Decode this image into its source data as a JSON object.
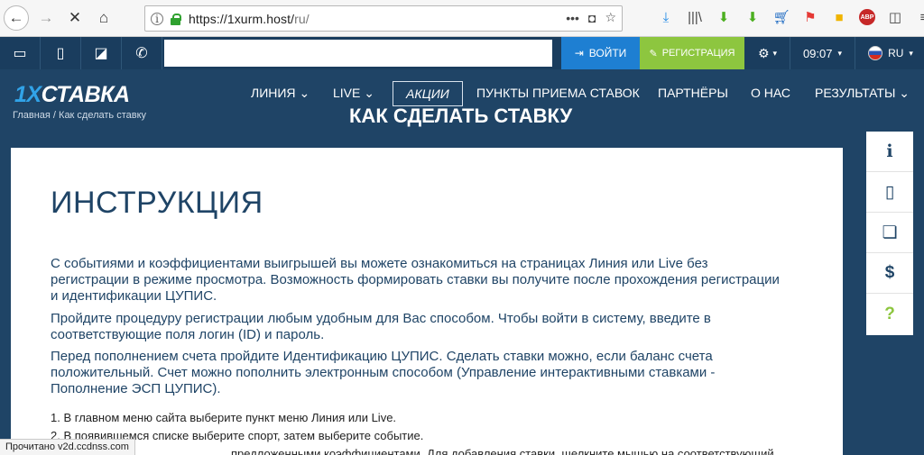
{
  "browser": {
    "url_host": "https://1xurm.host/",
    "url_path": "ru/",
    "status_text": "Прочитано v2d.ccdnss.com"
  },
  "topbar": {
    "login_label": "ВОЙТИ",
    "register_label": "РЕГИСТРАЦИЯ",
    "time": "09:07",
    "language": "RU"
  },
  "nav": {
    "logo_prefix": "1X",
    "logo_word": "СТАВКА",
    "items": [
      "ЛИНИЯ",
      "LIVE",
      "АКЦИИ",
      "ПУНКТЫ ПРИЕМА СТАВОК",
      "ПАРТНЁРЫ",
      "О НАС",
      "РЕЗУЛЬТАТЫ"
    ]
  },
  "page": {
    "breadcrumb": "Главная / Как сделать ставку",
    "heading": "КАК СДЕЛАТЬ СТАВКУ",
    "title": "ИНСТРУКЦИЯ",
    "paragraphs": [
      "С событиями и коэффициентами выигрышей вы можете ознакомиться на страницах Линия или Live без регистрации в режиме просмотра. Возможность формировать ставки вы получите после прохождения регистрации и идентификации ЦУПИС.",
      "Пройдите процедуру регистрации любым удобным для Вас способом. Чтобы войти в систему, введите в соответствующие поля логин (ID) и пароль.",
      "Перед пополнением счета пройдите Идентификацию ЦУПИС. Сделать ставки можно, если баланс счета положительный. Счет можно пополнить электронным способом (Управление интерактивными ставками - Пополнение ЭСП ЦУПИС)."
    ],
    "steps": [
      "1. В главном меню сайта выберите пункт меню Линия или Live.",
      "2. В появившемся списке выберите спорт, затем выберите событие.",
      "предложенными коэффициентами. Для добавления ставки, щелкните мышью на соответствующий"
    ]
  },
  "side_panel": {
    "items": [
      "i",
      "mobile",
      "book",
      "$",
      "?"
    ]
  }
}
